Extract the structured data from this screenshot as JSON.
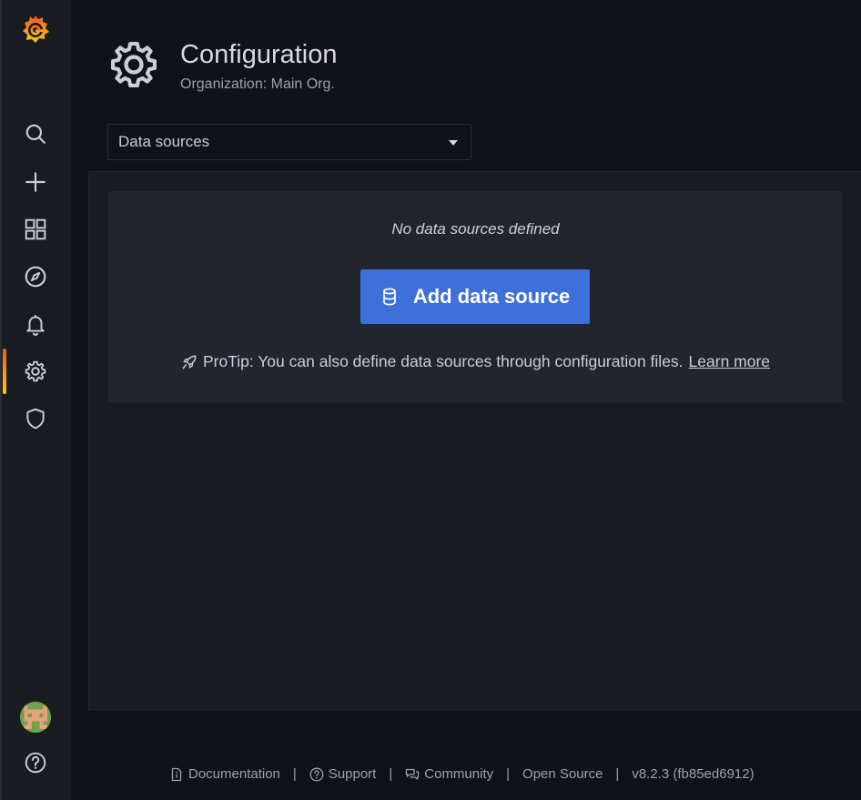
{
  "header": {
    "title": "Configuration",
    "subtitle": "Organization: Main Org."
  },
  "nav_select": {
    "selected": "Data sources"
  },
  "sidebar": {
    "items": [
      {
        "name": "search",
        "icon": "search-icon"
      },
      {
        "name": "create",
        "icon": "plus-icon"
      },
      {
        "name": "dashboards",
        "icon": "apps-icon"
      },
      {
        "name": "explore",
        "icon": "compass-icon"
      },
      {
        "name": "alerting",
        "icon": "bell-icon"
      },
      {
        "name": "configuration",
        "icon": "gear-icon",
        "active": true
      },
      {
        "name": "server-admin",
        "icon": "shield-icon"
      }
    ],
    "bottom": [
      {
        "name": "profile",
        "icon": "avatar"
      },
      {
        "name": "help",
        "icon": "question-circle-icon"
      }
    ]
  },
  "empty_state": {
    "title": "No data sources defined",
    "button_label": "Add data source",
    "protip_text": "ProTip: You can also define data sources through configuration files.",
    "protip_link": "Learn more"
  },
  "footer": {
    "documentation": "Documentation",
    "support": "Support",
    "community": "Community",
    "open_source": "Open Source",
    "version": "v8.2.3 (fb85ed6912)",
    "separator": "|"
  },
  "colors": {
    "background": "#111217",
    "panel": "#181b1f",
    "card": "#22252b",
    "primary_button": "#3d71d9",
    "active_indicator": "#f05a28"
  }
}
